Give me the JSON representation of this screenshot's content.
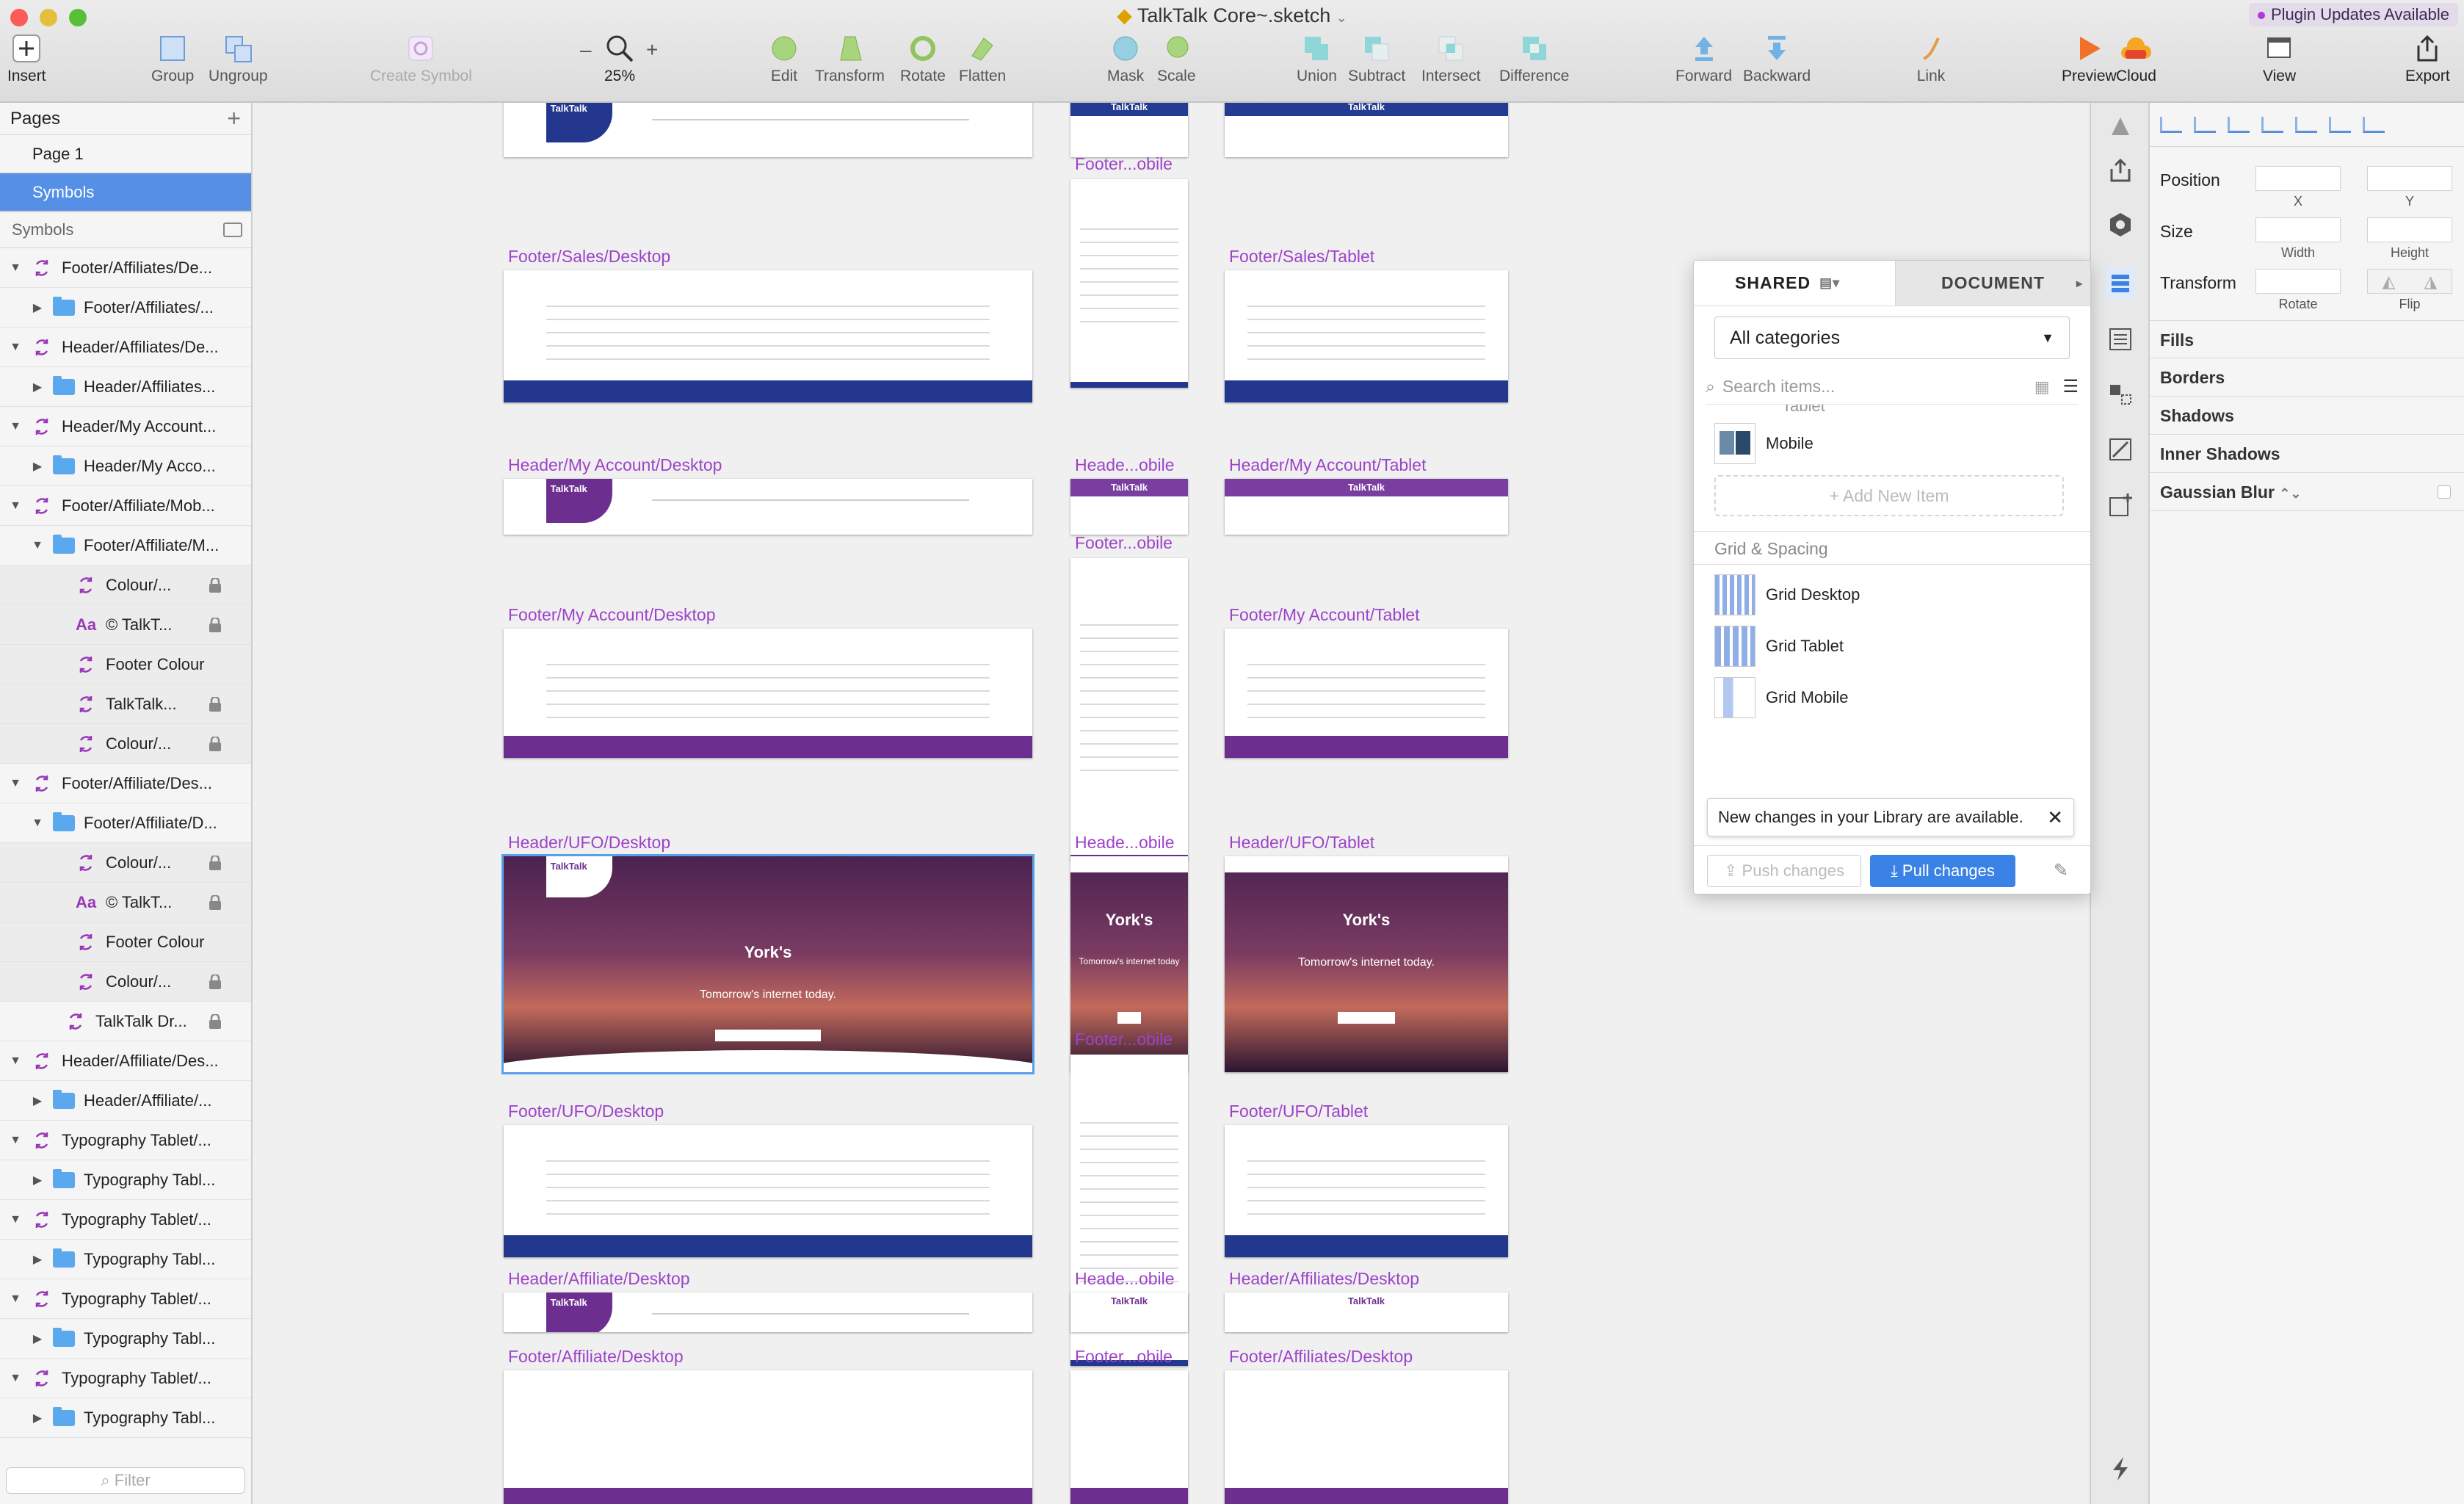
{
  "window": {
    "title": "TalkTalk Core~.sketch",
    "plugin_badge": "Plugin Updates Available"
  },
  "toolbar": {
    "insert": "Insert",
    "group": "Group",
    "ungroup": "Ungroup",
    "create_symbol": "Create Symbol",
    "zoom_minus": "–",
    "zoom_plus": "+",
    "zoom": "25%",
    "edit": "Edit",
    "transform": "Transform",
    "rotate": "Rotate",
    "flatten": "Flatten",
    "mask": "Mask",
    "scale": "Scale",
    "union": "Union",
    "subtract": "Subtract",
    "intersect": "Intersect",
    "difference": "Difference",
    "forward": "Forward",
    "backward": "Backward",
    "link": "Link",
    "preview": "Preview",
    "cloud": "Cloud",
    "view": "View",
    "export": "Export"
  },
  "sidebar": {
    "pages_header": "Pages",
    "pages": [
      "Page 1",
      "Symbols"
    ],
    "symbols_header": "Symbols",
    "layers": [
      {
        "indent": 0,
        "type": "symbol",
        "open": true,
        "label": "Footer/Affiliates/De..."
      },
      {
        "indent": 1,
        "type": "folder",
        "open": false,
        "label": "Footer/Affiliates/..."
      },
      {
        "indent": 0,
        "type": "symbol",
        "open": true,
        "label": "Header/Affiliates/De..."
      },
      {
        "indent": 1,
        "type": "folder",
        "open": false,
        "label": "Header/Affiliates..."
      },
      {
        "indent": 0,
        "type": "symbol",
        "open": true,
        "label": "Header/My Account..."
      },
      {
        "indent": 1,
        "type": "folder",
        "open": false,
        "label": "Header/My Acco..."
      },
      {
        "indent": 0,
        "type": "symbol",
        "open": true,
        "label": "Footer/Affiliate/Mob..."
      },
      {
        "indent": 1,
        "type": "folder",
        "open": true,
        "label": "Footer/Affiliate/M..."
      },
      {
        "indent": 2,
        "type": "symbol",
        "locked": true,
        "label": "Colour/..."
      },
      {
        "indent": 2,
        "type": "text",
        "locked": true,
        "label": "© TalkT..."
      },
      {
        "indent": 2,
        "type": "symbol",
        "locked": false,
        "label": "Footer Colour"
      },
      {
        "indent": 2,
        "type": "symbol",
        "locked": true,
        "label": "TalkTalk..."
      },
      {
        "indent": 2,
        "type": "symbol",
        "locked": true,
        "label": "Colour/..."
      },
      {
        "indent": 0,
        "type": "symbol",
        "open": true,
        "label": "Footer/Affiliate/Des..."
      },
      {
        "indent": 1,
        "type": "folder",
        "open": true,
        "label": "Footer/Affiliate/D..."
      },
      {
        "indent": 2,
        "type": "symbol",
        "locked": true,
        "label": "Colour/..."
      },
      {
        "indent": 2,
        "type": "text",
        "locked": true,
        "label": "© TalkT..."
      },
      {
        "indent": 2,
        "type": "symbol",
        "locked": false,
        "label": "Footer Colour"
      },
      {
        "indent": 2,
        "type": "symbol",
        "locked": true,
        "label": "Colour/..."
      },
      {
        "indent": 1.5,
        "type": "symbol",
        "locked": true,
        "label": "TalkTalk Dr..."
      },
      {
        "indent": 0,
        "type": "symbol",
        "open": true,
        "label": "Header/Affiliate/Des..."
      },
      {
        "indent": 1,
        "type": "folder",
        "open": false,
        "label": "Header/Affiliate/..."
      },
      {
        "indent": 0,
        "type": "symbol",
        "open": true,
        "label": "Typography Tablet/..."
      },
      {
        "indent": 1,
        "type": "folder",
        "open": false,
        "label": "Typography Tabl..."
      },
      {
        "indent": 0,
        "type": "symbol",
        "open": true,
        "label": "Typography Tablet/..."
      },
      {
        "indent": 1,
        "type": "folder",
        "open": false,
        "label": "Typography Tabl..."
      },
      {
        "indent": 0,
        "type": "symbol",
        "open": true,
        "label": "Typography Tablet/..."
      },
      {
        "indent": 1,
        "type": "folder",
        "open": false,
        "label": "Typography Tabl..."
      },
      {
        "indent": 0,
        "type": "symbol",
        "open": true,
        "label": "Typography Tablet/..."
      },
      {
        "indent": 1,
        "type": "folder",
        "open": false,
        "label": "Typography Tabl..."
      }
    ],
    "filter_placeholder": "Filter"
  },
  "canvas": {
    "artboards": [
      {
        "label": "",
        "kind": "header-blue"
      },
      {
        "label": "",
        "kind": "mbar-blue",
        "brand": "TalkTalk"
      },
      {
        "label": "",
        "kind": "mbar-blue",
        "brand": "TalkTalk"
      },
      {
        "label": "Footer...obile",
        "kind": "footer-mobile-blue"
      },
      {
        "label": "Footer/Sales/Desktop",
        "kind": "footer-blue"
      },
      {
        "label": "Footer/Sales/Tablet",
        "kind": "footer-blue"
      },
      {
        "label": "Header/My Account/Desktop",
        "kind": "header-purple"
      },
      {
        "label": "Heade...obile",
        "kind": "mbar-purple",
        "brand": "TalkTalk"
      },
      {
        "label": "Header/My Account/Tablet",
        "kind": "mbar-purple",
        "brand": "TalkTalk"
      },
      {
        "label": "Footer...obile",
        "kind": "footer-mobile-purple"
      },
      {
        "label": "Footer/My Account/Desktop",
        "kind": "footer-purple"
      },
      {
        "label": "Footer/My Account/Tablet",
        "kind": "footer-purple"
      },
      {
        "label": "Header/UFO/Desktop",
        "kind": "ufo",
        "selected": true,
        "hero": "York's",
        "tagline": "Tomorrow's internet today."
      },
      {
        "label": "Heade...obile",
        "kind": "ufo-mobile",
        "hero": "York's",
        "tagline": "Tomorrow's internet today"
      },
      {
        "label": "Header/UFO/Tablet",
        "kind": "ufo-tablet",
        "hero": "York's",
        "tagline": "Tomorrow's internet today."
      },
      {
        "label": "Footer...obile",
        "kind": "footer-mobile-blue"
      },
      {
        "label": "Footer/UFO/Desktop",
        "kind": "footer-blue"
      },
      {
        "label": "Footer/UFO/Tablet",
        "kind": "footer-blue"
      },
      {
        "label": "Header/Affiliate/Desktop",
        "kind": "header-affiliate"
      },
      {
        "label": "Heade...obile",
        "kind": "mbar-white",
        "brand": "TalkTalk"
      },
      {
        "label": "Header/Affiliates/Desktop",
        "kind": "mbar-white",
        "brand": "TalkTalk"
      },
      {
        "label": "Footer/Affiliate/Desktop",
        "kind": "footer-purple-plain"
      },
      {
        "label": "Footer...obile",
        "kind": "footer-purple-plain"
      },
      {
        "label": "Footer/Affiliates/Desktop",
        "kind": "footer-purple-plain"
      }
    ]
  },
  "library": {
    "tab_shared": "SHARED",
    "tab_document": "DOCUMENT",
    "category": "All categories",
    "search_placeholder": "Search items...",
    "partial_item": "Tablet",
    "items_top": [
      "Mobile"
    ],
    "add_new": "+ Add New Item",
    "section_grid": "Grid & Spacing",
    "grid_items": [
      "Grid Desktop",
      "Grid Tablet",
      "Grid Mobile"
    ],
    "toast": "New changes in your Library are available.",
    "push": "Push changes",
    "pull": "Pull changes"
  },
  "inspector": {
    "position": "Position",
    "x": "X",
    "y": "Y",
    "size": "Size",
    "width": "Width",
    "height": "Height",
    "transform": "Transform",
    "rotate": "Rotate",
    "flip": "Flip",
    "fills": "Fills",
    "borders": "Borders",
    "shadows": "Shadows",
    "inner_shadows": "Inner Shadows",
    "blur": "Gaussian Blur"
  },
  "colors": {
    "accent": "#5690e6",
    "artboard_label": "#9d43c9",
    "brand_blue": "#24378f",
    "brand_purple": "#6d2f8f"
  }
}
